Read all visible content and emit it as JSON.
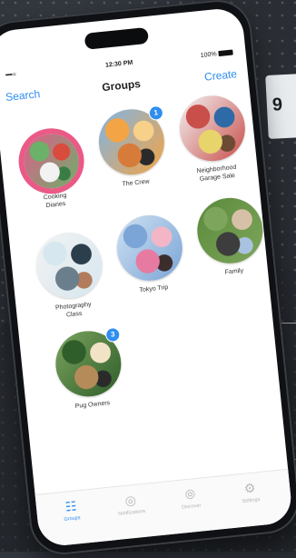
{
  "status": {
    "signal": "••••• ≈",
    "time": "12:30 PM",
    "battery": "100%"
  },
  "nav": {
    "left": "Search",
    "title": "Groups",
    "right": "Create"
  },
  "side_number": "9",
  "groups": [
    {
      "label": "Cooking\nDiaries",
      "badge": null,
      "colors": [
        "#6bb169",
        "#d94b3c",
        "#f2f2f2",
        "#3a7d44",
        "#e25b8c"
      ]
    },
    {
      "label": "The Crew",
      "badge": "1",
      "colors": [
        "#f3a444",
        "#f7d089",
        "#d77b3a",
        "#2a2a2a",
        "#7fb4e6"
      ]
    },
    {
      "label": "Neighborhood\nGarage Sale",
      "badge": null,
      "colors": [
        "#c94f4b",
        "#2d6aa6",
        "#e7d46b",
        "#6d4a33",
        "#f2f2f2"
      ]
    },
    {
      "label": "Photography\nClass",
      "badge": null,
      "colors": [
        "#d6e7ef",
        "#2b3e4c",
        "#6a7e8c",
        "#b27c5c",
        "#f2f2f2"
      ]
    },
    {
      "label": "Tokyo Trip",
      "badge": null,
      "colors": [
        "#7aa5d6",
        "#f2b6c7",
        "#e77aa1",
        "#3c2d2d",
        "#cfe1f2"
      ]
    },
    {
      "label": "Family",
      "badge": null,
      "colors": [
        "#7ea55c",
        "#d7c0a8",
        "#3d3d3d",
        "#a9c2e0",
        "#5a8a3a"
      ]
    },
    {
      "label": "Pug Owners",
      "badge": "3",
      "colors": [
        "#2f5e2a",
        "#f2e3c7",
        "#b58b59",
        "#2a2a2a",
        "#7aa35e"
      ]
    }
  ],
  "tabs": [
    {
      "label": "Groups",
      "icon": "grid-icon",
      "active": true
    },
    {
      "label": "Notifications",
      "icon": "globe-icon",
      "active": false
    },
    {
      "label": "Discover",
      "icon": "compass-icon",
      "active": false
    },
    {
      "label": "Settings",
      "icon": "gear-icon",
      "active": false
    }
  ]
}
